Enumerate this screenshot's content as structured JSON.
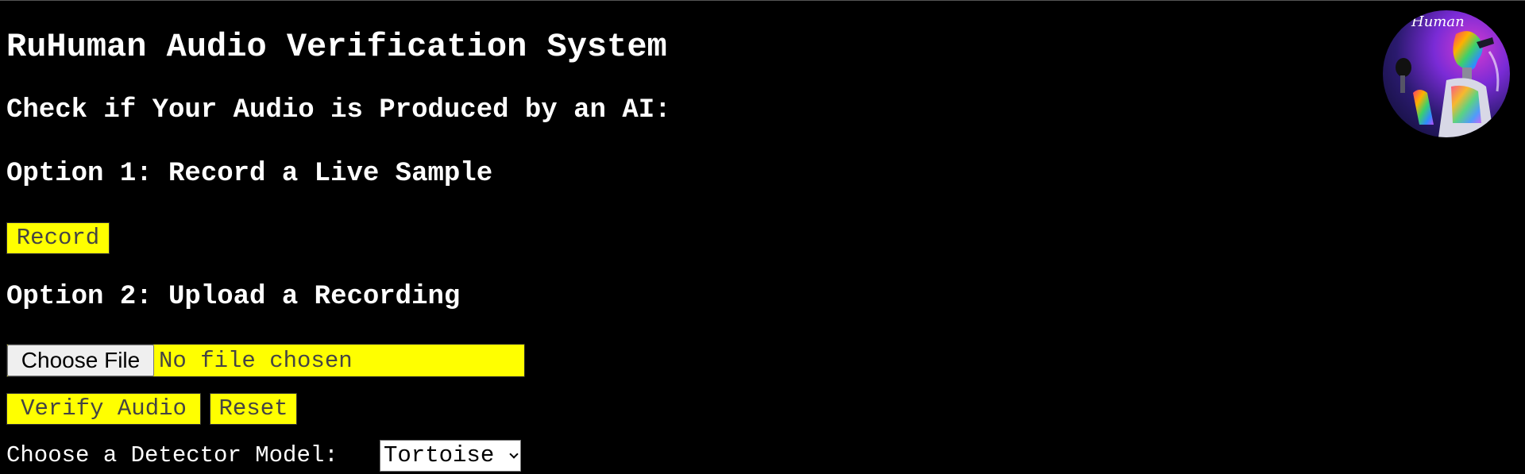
{
  "header": {
    "title": "RuHuman Audio Verification System",
    "subtitle": "Check if Your Audio is Produced by an AI:"
  },
  "option1": {
    "heading": "Option 1: Record a Live Sample",
    "record_label": "Record"
  },
  "option2": {
    "heading": "Option 2: Upload a Recording",
    "choose_file_label": "Choose File",
    "file_status": "No file chosen"
  },
  "actions": {
    "verify_label": "Verify Audio",
    "reset_label": "Reset"
  },
  "model": {
    "label": "Choose a Detector Model:",
    "selected": "Tortoise"
  },
  "logo": {
    "text": "Human",
    "icon": "robot-logo-icon"
  },
  "colors": {
    "background": "#000000",
    "accent": "#ffff00",
    "text": "#ffffff"
  }
}
